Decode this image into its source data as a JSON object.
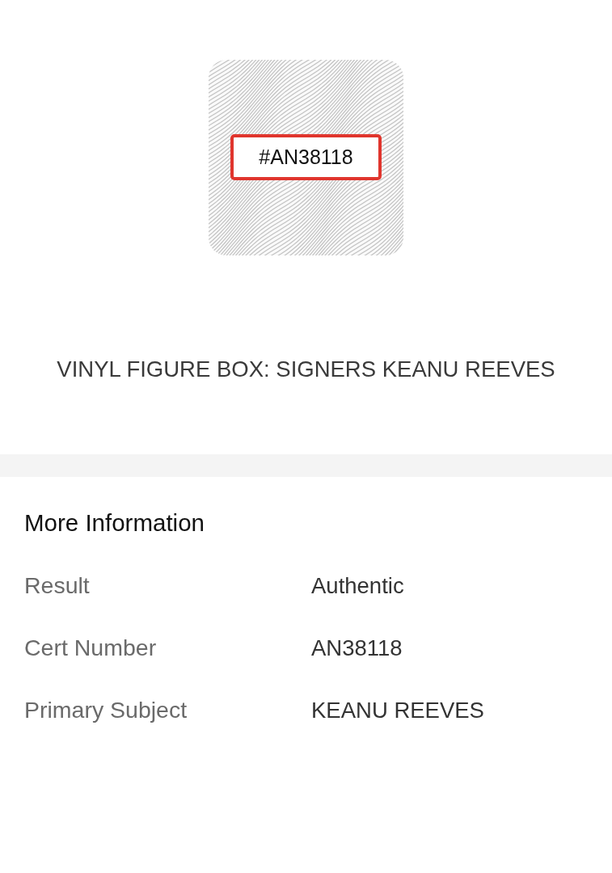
{
  "certificate_image": {
    "label": "#AN38118"
  },
  "title": "VINYL FIGURE BOX: SIGNERS KEANU REEVES",
  "more_information": {
    "heading": "More Information",
    "rows": [
      {
        "label": "Result",
        "value": "Authentic"
      },
      {
        "label": "Cert Number",
        "value": "AN38118"
      },
      {
        "label": "Primary Subject",
        "value": "KEANU REEVES"
      }
    ]
  }
}
